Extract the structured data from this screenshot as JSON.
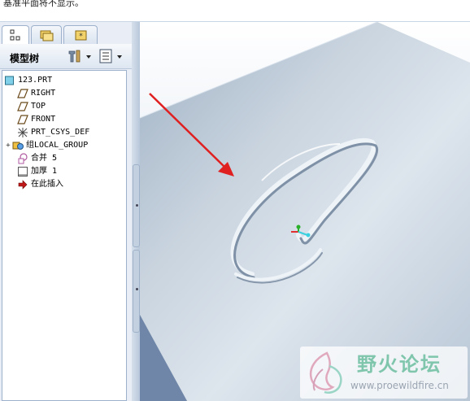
{
  "message_bar": {
    "text": "基准平面将不显示。"
  },
  "model_tree": {
    "title": "模型树",
    "tabs": [
      "model-tree-icon",
      "folder-icon",
      "favorites-icon"
    ],
    "items": [
      {
        "label": "123.PRT",
        "icon": "part-icon"
      },
      {
        "label": "RIGHT",
        "icon": "datum-plane-icon"
      },
      {
        "label": "TOP",
        "icon": "datum-plane-icon"
      },
      {
        "label": "FRONT",
        "icon": "datum-plane-icon"
      },
      {
        "label": "PRT_CSYS_DEF",
        "icon": "csys-icon"
      },
      {
        "label": "组LOCAL_GROUP",
        "icon": "group-icon"
      },
      {
        "label": "合并 5",
        "icon": "merge-icon"
      },
      {
        "label": "加厚 1",
        "icon": "thicken-icon"
      },
      {
        "label": "在此插入",
        "icon": "insert-here-icon"
      }
    ]
  },
  "watermark": {
    "title": "野火论坛",
    "url": "www.proewildfire.cn"
  },
  "colors": {
    "background_top": "#ffffff",
    "background_bottom": "#9fb0c6",
    "arrow": "#e02020",
    "watermark": "#7fc6ad"
  }
}
